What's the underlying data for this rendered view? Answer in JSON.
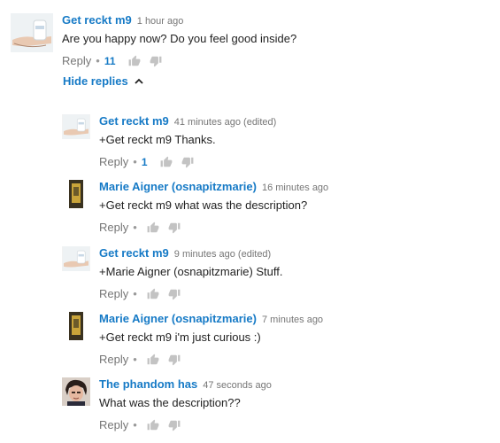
{
  "hide_replies_label": "Hide replies",
  "reply_label": "Reply",
  "separator": "•",
  "comments": [
    {
      "author": "Get reckt m9",
      "time": "1 hour ago",
      "text": "Are you happy now? Do you feel good inside?",
      "likes": "11"
    },
    {
      "author": "Get reckt m9",
      "time": "41 minutes ago (edited)",
      "text": "+Get reckt m9 Thanks.",
      "likes": "1"
    },
    {
      "author": "Marie Aigner (osnapitzmarie)",
      "time": "16 minutes ago",
      "text": "+Get reckt m9 what was the description?",
      "likes": ""
    },
    {
      "author": "Get reckt m9",
      "time": "9 minutes ago (edited)",
      "text": "+Marie Aigner (osnapitzmarie) Stuff.",
      "likes": ""
    },
    {
      "author": "Marie Aigner (osnapitzmarie)",
      "time": "7 minutes ago",
      "text": "+Get reckt m9 i'm just curious :)",
      "likes": ""
    },
    {
      "author": "The phandom has",
      "time": "47 seconds ago",
      "text": "What was the description??",
      "likes": ""
    }
  ],
  "icons": {
    "like": "thumbs-up-icon",
    "dislike": "thumbs-down-icon",
    "chevron": "chevron-up-icon"
  },
  "colors": {
    "link": "#167ac6",
    "muted": "#767676",
    "thumb": "#c3c3c3"
  }
}
